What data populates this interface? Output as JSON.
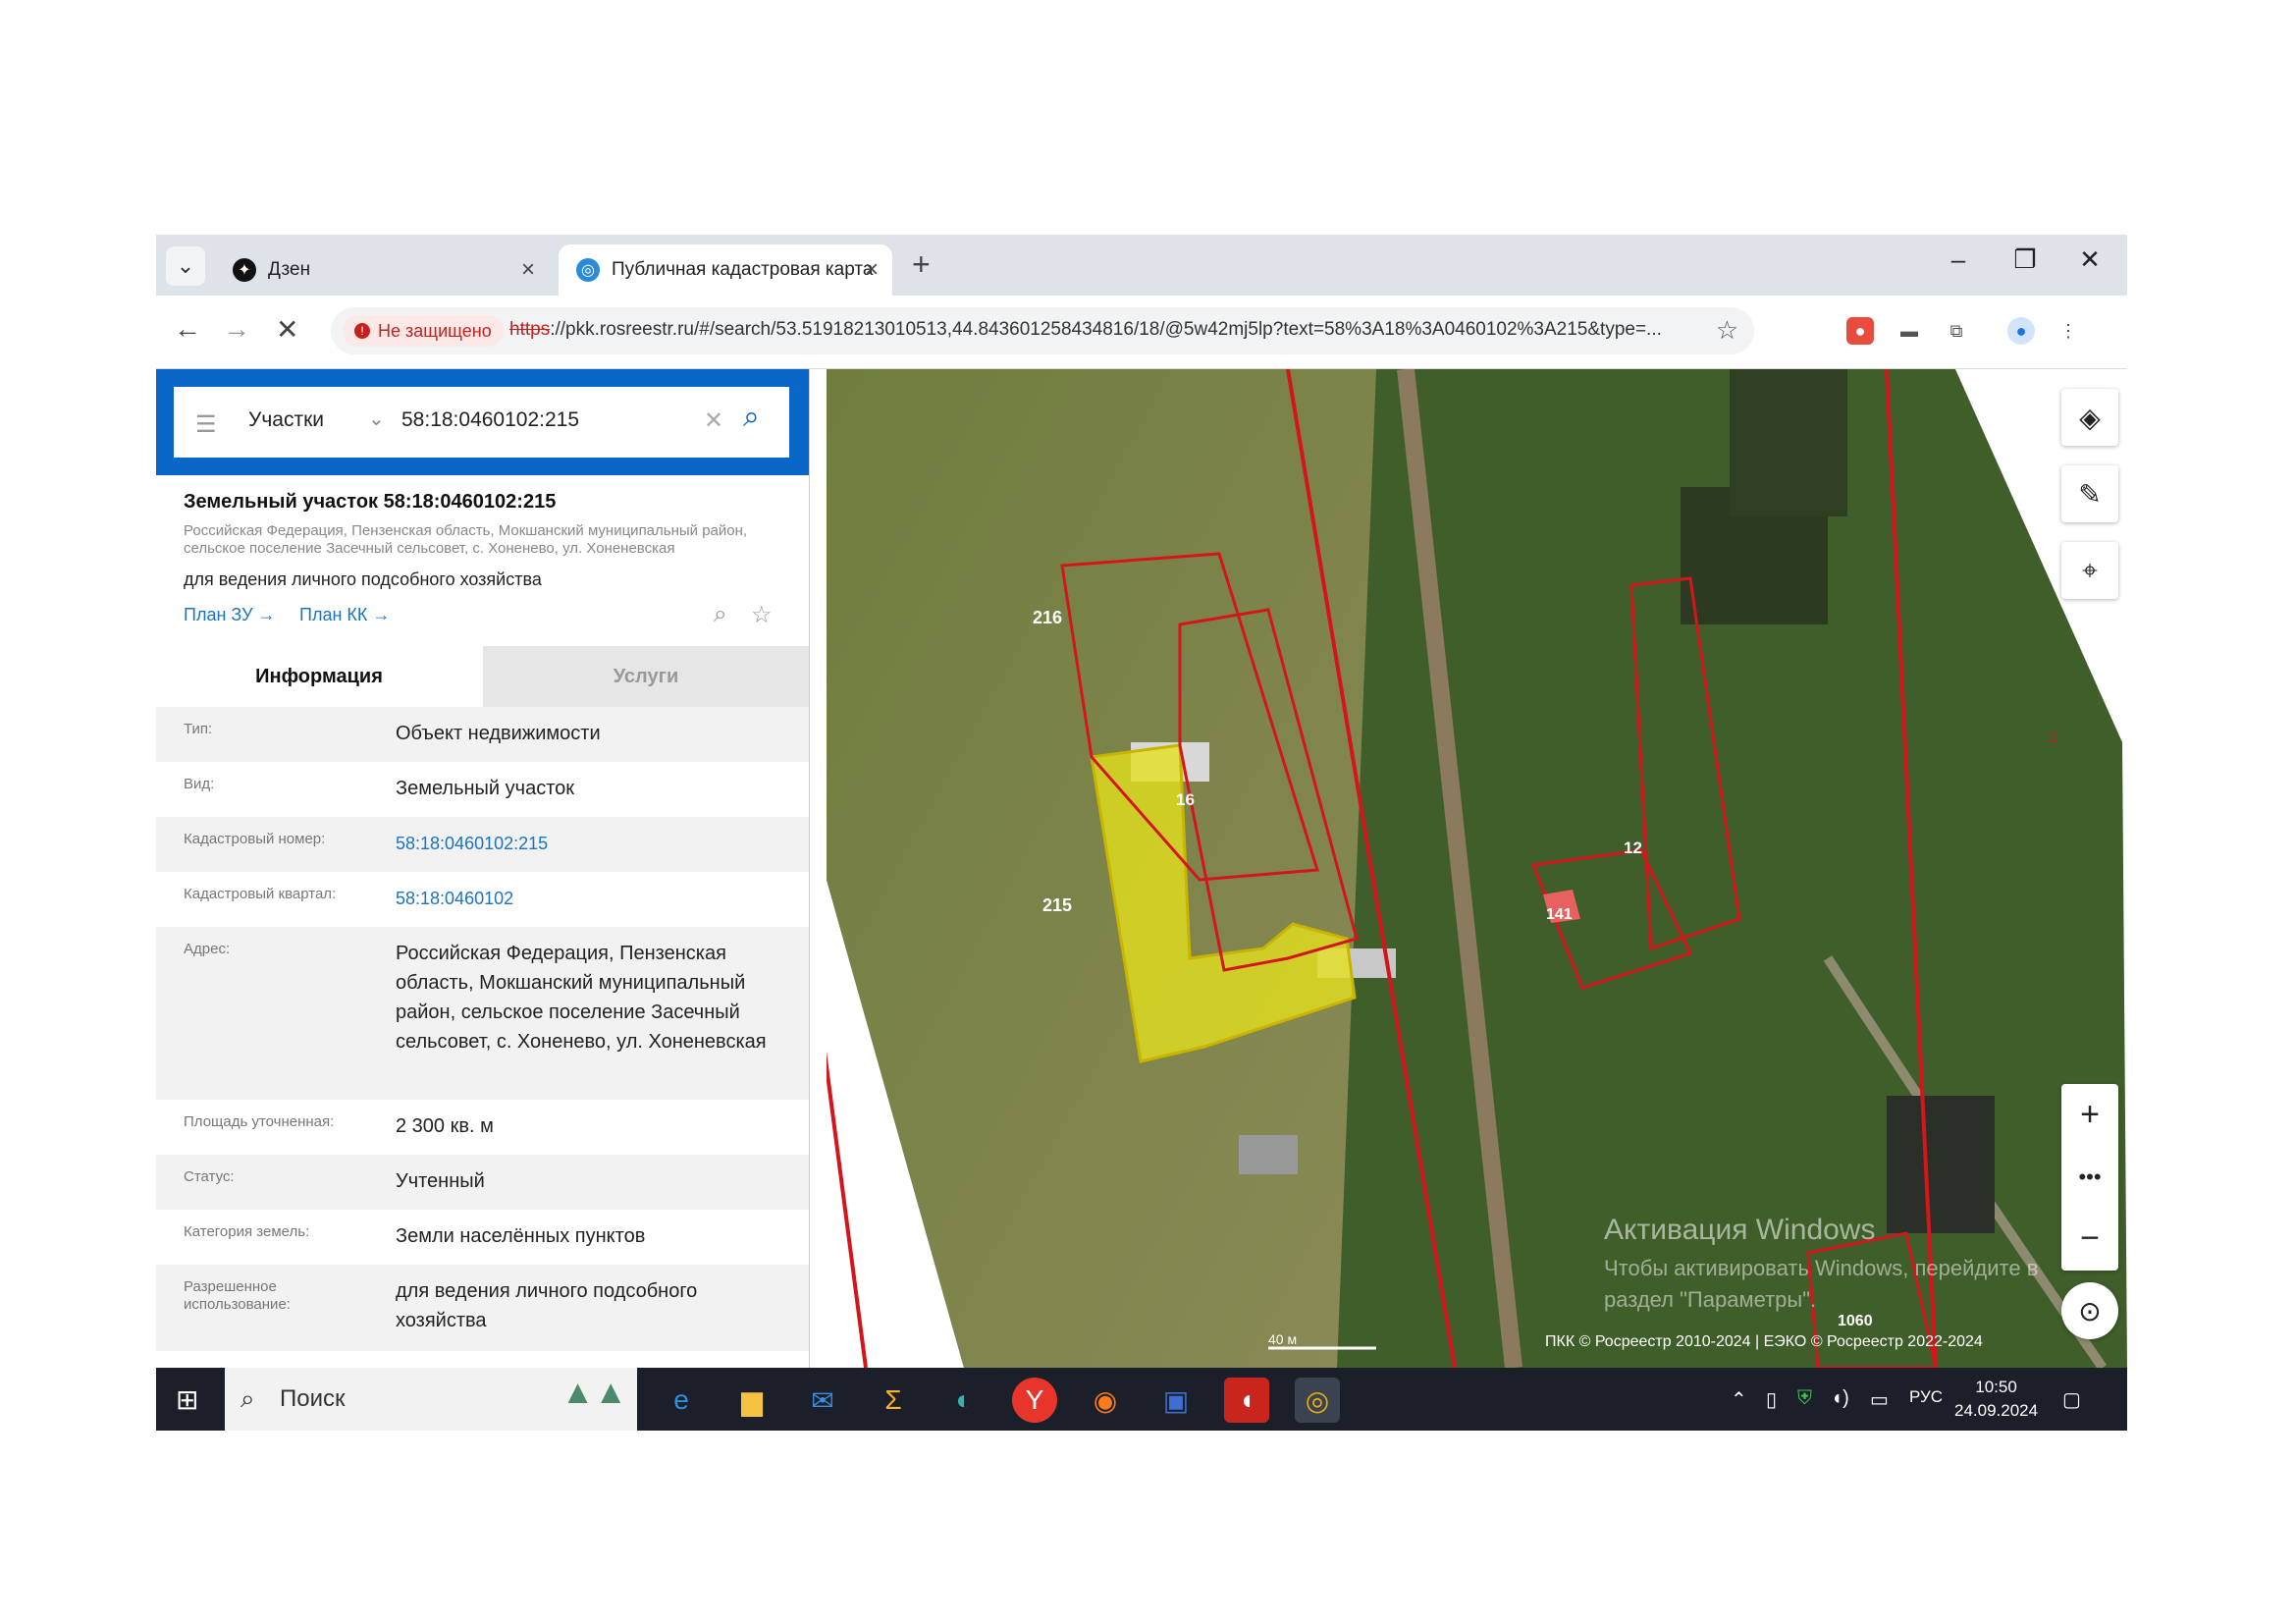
{
  "browser": {
    "tabs": [
      {
        "title": "Дзен",
        "active": false,
        "favicon": "dzen-icon"
      },
      {
        "title": "Публичная кадастровая карта",
        "active": true,
        "favicon": "globe-icon"
      }
    ],
    "insecure_label": "Не защищено",
    "url_scheme": "https",
    "url_rest": "://pkk.rosreestr.ru/#/search/53.51918213010513,44.843601258434816/18/@5w42mj5lp?text=58%3A18%3A0460102%3A215&type=..."
  },
  "search": {
    "category": "Участки",
    "query": "58:18:0460102:215"
  },
  "parcel": {
    "title": "Земельный участок 58:18:0460102:215",
    "address_short": "Российская Федерация, Пензенская область, Мокшанский муниципальный район, сельское поселение Засечный сельсовет, с. Хоненево, ул. Хоненевская",
    "use": "для ведения личного подсобного хозяйства",
    "plan_zu": "План ЗУ →",
    "plan_kk": "План КК →"
  },
  "info_tabs": [
    "Информация",
    "Услуги"
  ],
  "rows": [
    {
      "key": "Тип:",
      "value": "Объект недвижимости"
    },
    {
      "key": "Вид:",
      "value": "Земельный участок"
    },
    {
      "key": "Кадастровый номер:",
      "value": "58:18:0460102:215"
    },
    {
      "key": "Кадастровый квартал:",
      "value": "58:18:0460102"
    },
    {
      "key": "Адрес:",
      "value": "Российская Федерация, Пензенская область, Мокшанский муниципальный район, сельское поселение Засечный сельсовет, с. Хоненево, ул. Хоненевская"
    },
    {
      "key": "Площадь уточненная:",
      "value": "2 300 кв. м"
    },
    {
      "key": "Статус:",
      "value": "Учтенный"
    },
    {
      "key": "Категория земель:",
      "value": "Земли населённых пунктов"
    },
    {
      "key": "Разрешенное использование:",
      "value": "для ведения личного подсобного хозяйства"
    }
  ],
  "map": {
    "labels": [
      "216",
      "215",
      "16",
      "12",
      "141",
      "1060",
      "1"
    ],
    "scale": "40 м",
    "copyright": "ПКК © Росреестр 2010-2024 | ЕЭКО © Росреестр 2022-2024",
    "watermark_title": "Активация Windows",
    "watermark_text": "Чтобы активировать Windows, перейдите в раздел \"Параметры\"."
  },
  "taskbar": {
    "search_label": "Поиск",
    "lang": "РУС",
    "time": "10:50",
    "date": "24.09.2024"
  }
}
